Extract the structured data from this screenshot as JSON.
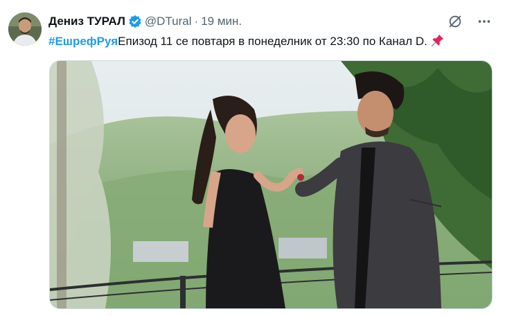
{
  "tweet": {
    "author_name": "Дениз ТУРАЛ",
    "handle": "@DTural",
    "separator": "·",
    "time": "19 мин.",
    "hashtag": "#ЕшрефРуя",
    "text": "Епизод 11 се повтаря в понеделник от 23:30 по Канал D.",
    "emoji_icon": "pushpin-icon"
  },
  "colors": {
    "accent": "#1d9bf0",
    "text": "#0f1419",
    "secondary": "#536471"
  },
  "actions": {
    "grok_icon": "grok-icon",
    "more_icon": "more-icon"
  },
  "media": {
    "type": "photo"
  }
}
